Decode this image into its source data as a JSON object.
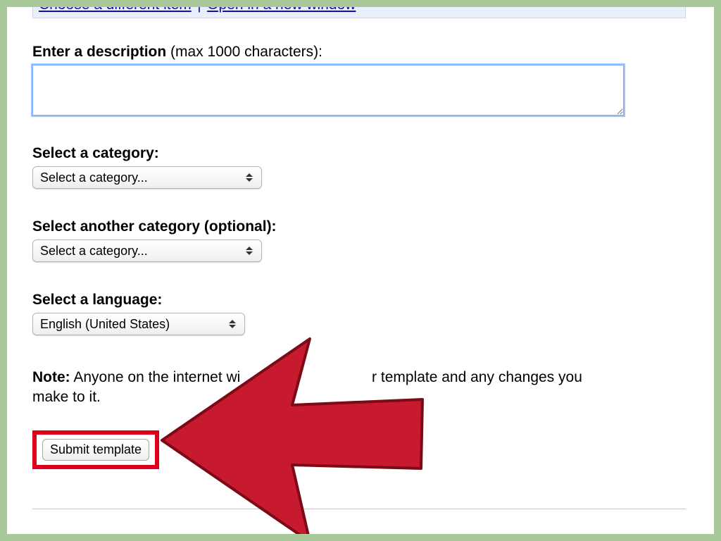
{
  "info_bar": {
    "link1": "Choose a different item",
    "sep": "|",
    "link2": "Open in a new window"
  },
  "description": {
    "label_bold": "Enter a description",
    "label_rest": " (max 1000 characters):",
    "value": ""
  },
  "category1": {
    "label": "Select a category:",
    "selected": "Select a category..."
  },
  "category2": {
    "label": "Select another category (optional):",
    "selected": "Select a category..."
  },
  "language": {
    "label": "Select a language:",
    "selected": "English (United States)"
  },
  "note": {
    "bold": "Note:",
    "text_before": " Anyone on the internet wi",
    "text_after": "r template and any changes you make to it."
  },
  "submit": {
    "label": "Submit template"
  },
  "colors": {
    "highlight_red": "#dc001c",
    "arrow_fill": "#c71a2f",
    "arrow_stroke": "#7c0a17",
    "frame_green": "#aac99a"
  }
}
